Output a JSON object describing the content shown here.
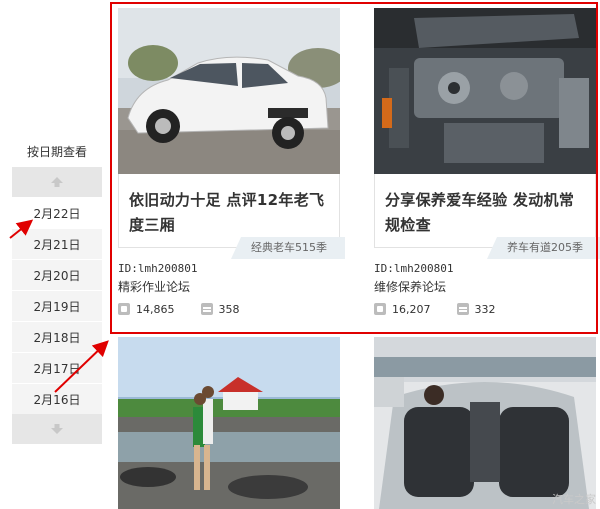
{
  "date_nav": {
    "title": "按日期查看",
    "items": [
      "2月22日",
      "2月21日",
      "2月20日",
      "2月19日",
      "2月18日",
      "2月17日",
      "2月16日"
    ],
    "active_index": 0
  },
  "cards": [
    {
      "caption": "依旧动力十足 点评12年老飞度三厢",
      "tag": "经典老车515季",
      "id_text": "ID:lmh200801",
      "forum": "精彩作业论坛",
      "likes": "14,865",
      "comments": "358"
    },
    {
      "caption": "分享保养爱车经验 发动机常规检查",
      "tag": "养车有道205季",
      "id_text": "ID:lmh200801",
      "forum": "维修保养论坛",
      "likes": "16,207",
      "comments": "332"
    }
  ],
  "watermark": "汽车之家",
  "colors": {
    "highlight_frame": "#e00000",
    "tag_bg": "#e9eff3"
  }
}
